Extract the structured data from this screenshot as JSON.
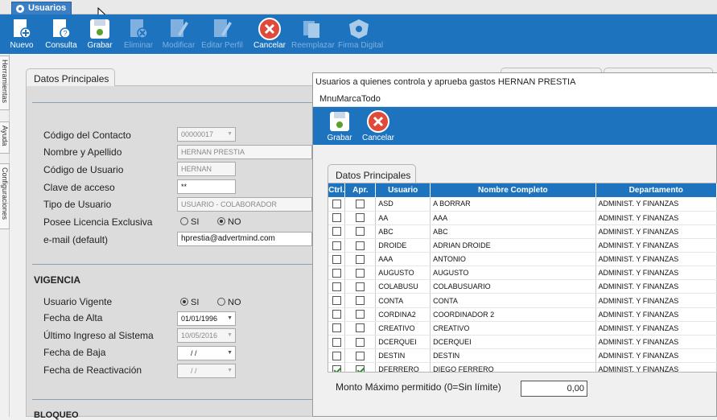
{
  "window_tab": "Usuarios",
  "toolbar": [
    {
      "label": "Nuevo",
      "icon": "new-doc-icon",
      "enabled": true
    },
    {
      "label": "Consulta",
      "icon": "query-icon",
      "enabled": true
    },
    {
      "label": "Grabar",
      "icon": "save-icon",
      "enabled": true
    },
    {
      "label": "Eliminar",
      "icon": "delete-icon",
      "enabled": false
    },
    {
      "label": "Modificar",
      "icon": "edit-icon",
      "enabled": false
    },
    {
      "label": "Editar Perfil",
      "icon": "edit-profile-icon",
      "enabled": false
    },
    {
      "label": "Cancelar",
      "icon": "cancel-icon",
      "enabled": true
    },
    {
      "label": "Reemplazar",
      "icon": "replace-icon",
      "enabled": false
    },
    {
      "label": "Firma Digital",
      "icon": "signature-icon",
      "enabled": false
    }
  ],
  "side_tabs": [
    "Herramientas",
    "Ayuda",
    "Configuraciones"
  ],
  "main_tab": "Datos Principales",
  "form": {
    "codigo_contacto_label": "Código del Contacto",
    "codigo_contacto": "00000017",
    "nombre_label": "Nombre y Apellido",
    "nombre": "HERNAN PRESTIA",
    "codigo_usuario_label": "Código de Usuario",
    "codigo_usuario": "HERNAN",
    "clave_label": "Clave de acceso",
    "clave": "**",
    "tipo_label": "Tipo de Usuario",
    "tipo": "USUARIO - COLABORADOR",
    "licencia_label": "Posee Licencia Exclusiva",
    "si": "SI",
    "no": "NO",
    "email_label": "e-mail (default)",
    "email": "hprestia@advertmind.com"
  },
  "vigencia": {
    "title": "VIGENCIA",
    "vigente_label": "Usuario Vigente",
    "si": "SI",
    "no": "NO",
    "alta_label": "Fecha de Alta",
    "alta": "01/01/1996",
    "ingreso_label": "Último Ingreso al Sistema",
    "ingreso": "10/05/2016",
    "baja_label": "Fecha de Baja",
    "baja": "/ /",
    "reactivacion_label": "Fecha de Reactivación",
    "reactivacion": "/ /"
  },
  "bloqueo_title": "BLOQUEO",
  "dialog": {
    "title": "Usuarios a quienes controla y aprueba gastos HERNAN PRESTIA",
    "menu": "MnuMarcaTodo",
    "save": "Grabar",
    "cancel": "Cancelar",
    "tab": "Datos Principales",
    "columns": [
      "Ctrl.",
      "Apr.",
      "Usuario",
      "Nombre Completo",
      "Departamento"
    ],
    "rows": [
      {
        "ctrl": false,
        "apr": false,
        "user": "ASD",
        "name": "A BORRAR",
        "dept": "ADMINIST. Y FINANZAS"
      },
      {
        "ctrl": false,
        "apr": false,
        "user": "AA",
        "name": "AAA",
        "dept": "ADMINIST. Y FINANZAS"
      },
      {
        "ctrl": false,
        "apr": false,
        "user": "ABC",
        "name": "ABC",
        "dept": "ADMINIST. Y FINANZAS"
      },
      {
        "ctrl": false,
        "apr": false,
        "user": "DROIDE",
        "name": "ADRIAN DROIDE",
        "dept": "ADMINIST. Y FINANZAS"
      },
      {
        "ctrl": false,
        "apr": false,
        "user": "AAA",
        "name": "ANTONIO",
        "dept": "ADMINIST. Y FINANZAS"
      },
      {
        "ctrl": false,
        "apr": false,
        "user": "AUGUSTO",
        "name": "AUGUSTO",
        "dept": "ADMINIST. Y FINANZAS"
      },
      {
        "ctrl": false,
        "apr": false,
        "user": "COLABUSU",
        "name": "COLABUSUARIO",
        "dept": "ADMINIST. Y FINANZAS"
      },
      {
        "ctrl": false,
        "apr": false,
        "user": "CONTA",
        "name": "CONTA",
        "dept": "ADMINIST. Y FINANZAS"
      },
      {
        "ctrl": false,
        "apr": false,
        "user": "CORDINA2",
        "name": "COORDINADOR 2",
        "dept": "ADMINIST. Y FINANZAS"
      },
      {
        "ctrl": false,
        "apr": false,
        "user": "CREATIVO",
        "name": "CREATIVO",
        "dept": "ADMINIST. Y FINANZAS"
      },
      {
        "ctrl": false,
        "apr": false,
        "user": "DCERQUEI",
        "name": "DCERQUEI",
        "dept": "ADMINIST. Y FINANZAS"
      },
      {
        "ctrl": false,
        "apr": false,
        "user": "DESTIN",
        "name": "DESTIN",
        "dept": "ADMINIST. Y FINANZAS"
      },
      {
        "ctrl": true,
        "apr": true,
        "user": "DFERRERO",
        "name": "DIEGO FERRERO",
        "dept": "ADMINIST. Y FINANZAS"
      }
    ],
    "monto_label": "Monto Máximo permitido (0=Sin límite)",
    "monto": "0,00"
  }
}
